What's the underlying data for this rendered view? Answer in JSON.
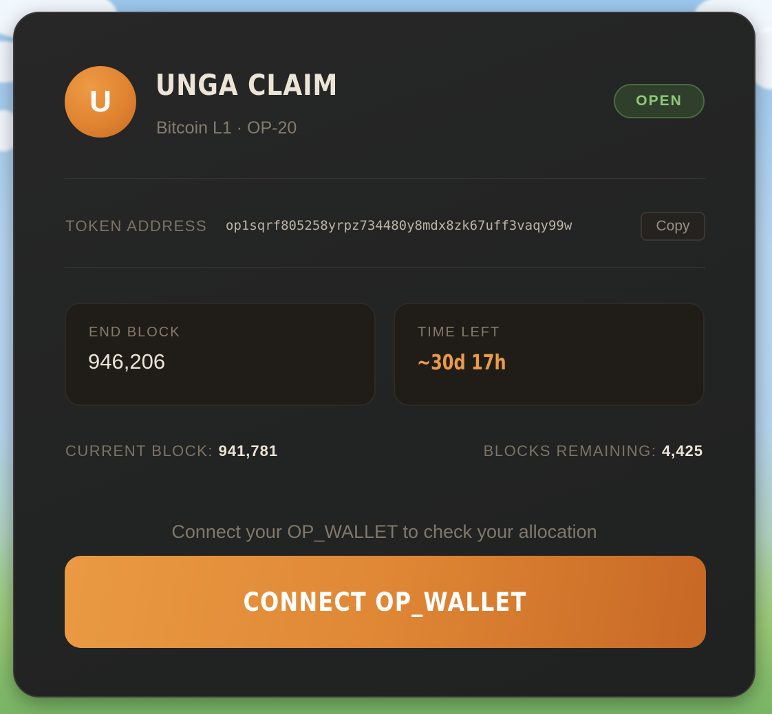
{
  "header": {
    "avatar_letter": "U",
    "title": "UNGA CLAIM",
    "subtitle": "Bitcoin L1 · OP-20",
    "status_badge": "OPEN"
  },
  "token": {
    "label": "TOKEN ADDRESS",
    "address": "op1sqrf805258yrpz734480y8mdx8zk67uff3vaqy99w",
    "copy_label": "Copy"
  },
  "stats": {
    "end_block": {
      "label": "END BLOCK",
      "value": "946,206"
    },
    "time_left": {
      "label": "TIME LEFT",
      "value": "~30d 17h"
    }
  },
  "meta": {
    "current_block_label": "CURRENT BLOCK:",
    "current_block_value": "941,781",
    "blocks_remaining_label": "BLOCKS REMAINING:",
    "blocks_remaining_value": "4,425"
  },
  "cta": {
    "prompt": "Connect your OP_WALLET to check your allocation",
    "button_label": "CONNECT OP_WALLET"
  },
  "colors": {
    "accent": "#e08a37",
    "status_open": "#8fc97a",
    "card_background": "#242424"
  }
}
